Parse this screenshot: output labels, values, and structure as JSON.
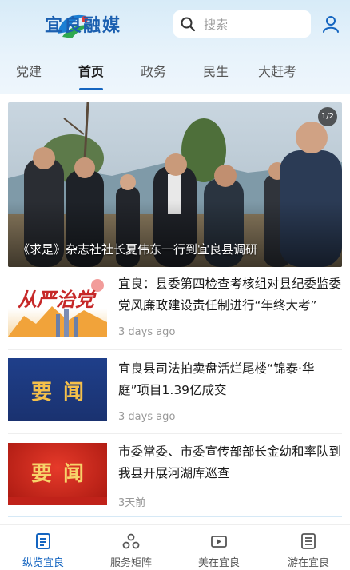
{
  "header": {
    "logo_text": "宜良融媒",
    "search_placeholder": "搜索"
  },
  "nav": {
    "tabs": [
      {
        "label": "党建",
        "active": false
      },
      {
        "label": "首页",
        "active": true
      },
      {
        "label": "政务",
        "active": false
      },
      {
        "label": "民生",
        "active": false
      },
      {
        "label": "大赶考",
        "active": false
      }
    ]
  },
  "hero": {
    "caption": "《求是》杂志社社长夏伟东一行到宜良县调研",
    "page_indicator": "1/2"
  },
  "news": [
    {
      "title": "宜良：县委第四检查考核组对县纪委监委党风廉政建设责任制进行“年终大考”",
      "time": "3 days ago",
      "thumb_text": "从严治党"
    },
    {
      "title": "宜良县司法拍卖盘活烂尾楼“锦泰·华庭”项目1.39亿成交",
      "time": "3 days ago",
      "thumb_text": "要闻"
    },
    {
      "title": "市委常委、市委宣传部部长金幼和率队到我县开展河湖库巡查",
      "time": "3天前",
      "thumb_text": "要闻"
    }
  ],
  "bottom_nav": [
    {
      "label": "纵览宜良",
      "active": true
    },
    {
      "label": "服务矩阵",
      "active": false
    },
    {
      "label": "美在宜良",
      "active": false
    },
    {
      "label": "游在宜良",
      "active": false
    }
  ],
  "colors": {
    "accent": "#1565c0",
    "header_bg": "#dcedf9"
  }
}
